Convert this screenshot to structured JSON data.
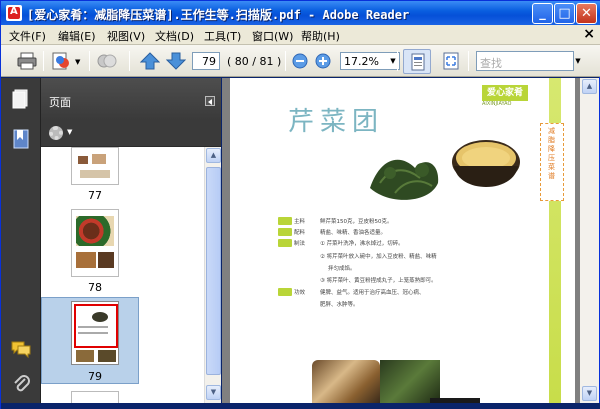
{
  "window": {
    "title": "[爱心家肴：减脂降压菜谱].王作生等.扫描版.pdf - Adobe Reader"
  },
  "menu": {
    "items": [
      "文件(F)",
      "编辑(E)",
      "视图(V)",
      "文档(D)",
      "工具(T)",
      "窗口(W)",
      "帮助(H)"
    ]
  },
  "toolbar": {
    "page_number": "79",
    "page_count": "( 80 / 81 )",
    "zoom": "17.2%",
    "search_placeholder": "查找"
  },
  "thumbnails_panel": {
    "title": "页面",
    "pages": [
      "77",
      "78",
      "79"
    ],
    "selected_page": "79"
  },
  "document": {
    "page_title": "芹菜团",
    "header_tag": "爱心家肴",
    "header_tag_en": "AIXINJIAYAO",
    "side_label": "减脂降压菜谱",
    "rows": [
      {
        "label": "主料",
        "text": "鲜芹菜150克，豆皮粉50克。"
      },
      {
        "label": "配料",
        "text": "精盐、味精、香油各适量。"
      },
      {
        "label": "制法",
        "text": "① 芹菜叶洗净，沸水焯过，切碎。"
      },
      {
        "label": "",
        "text": "② 将芹菜叶放入碗中，加入豆皮粉、精盐、味精"
      },
      {
        "label": "",
        "text": "拌匀成馅。"
      },
      {
        "label": "",
        "text": "③ 将芹菜叶、黄豆粉捏成丸子，上笼蒸熟即可。"
      },
      {
        "label": "功效",
        "text": "健脾、益气。适用于治疗高血压、冠心病、"
      },
      {
        "label": "",
        "text": "肥胖、水肿等。"
      }
    ]
  },
  "colors": {
    "accent_green": "#b9d538",
    "title_teal": "#7cb5c2",
    "selection_blue": "#b9d1ea",
    "titlebar_blue": "#0a5fe0"
  }
}
